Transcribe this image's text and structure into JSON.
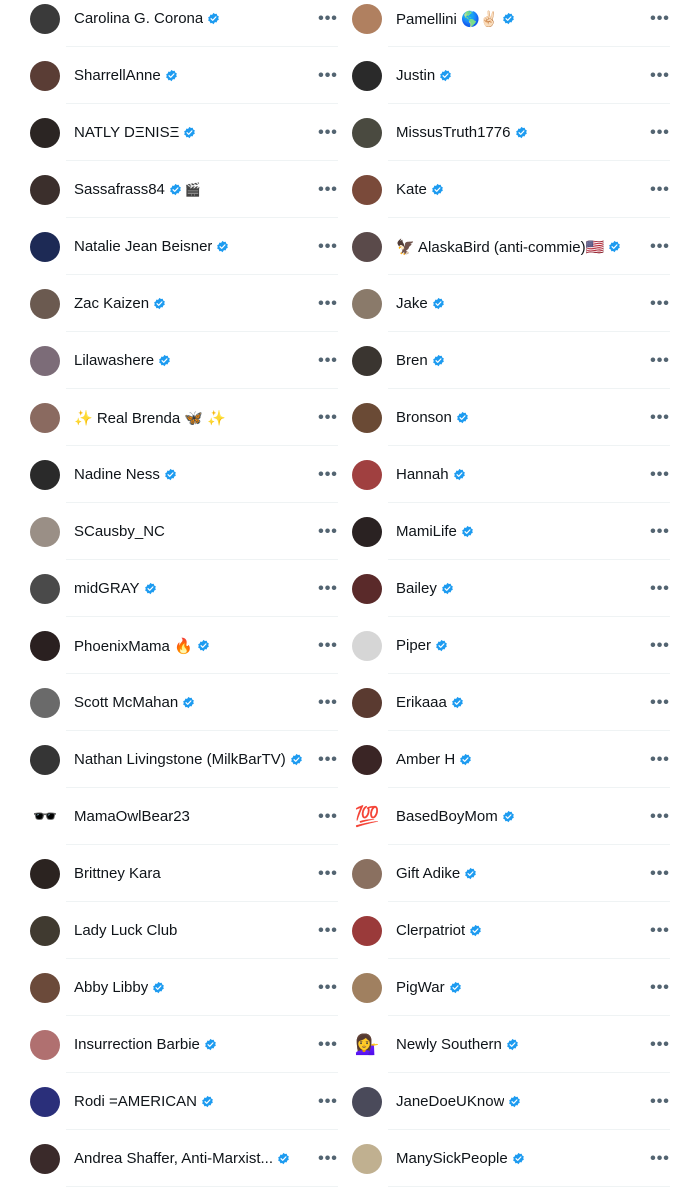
{
  "left_column": [
    {
      "name": "Carolina G. Corona",
      "verified": true,
      "extra": "",
      "avatar_color": "#3a3a3a",
      "avatar_emoji": ""
    },
    {
      "name": "SharrellAnne",
      "verified": true,
      "extra": "",
      "avatar_color": "#5a3d35",
      "avatar_emoji": ""
    },
    {
      "name": "NATLY DΞNISΞ",
      "verified": true,
      "extra": "",
      "avatar_color": "#2b2523",
      "avatar_emoji": ""
    },
    {
      "name": "Sassafrass84",
      "verified": true,
      "extra": "🎬",
      "avatar_color": "#3b2f2c",
      "avatar_emoji": ""
    },
    {
      "name": "Natalie Jean Beisner",
      "verified": true,
      "extra": "",
      "avatar_color": "#1d2a55",
      "avatar_emoji": ""
    },
    {
      "name": "Zac Kaizen",
      "verified": true,
      "extra": "",
      "avatar_color": "#6b5a50",
      "avatar_emoji": ""
    },
    {
      "name": "Lilawashere",
      "verified": true,
      "extra": "",
      "avatar_color": "#7c6c78",
      "avatar_emoji": ""
    },
    {
      "name": "✨ Real Brenda 🦋 ✨",
      "verified": false,
      "extra": "",
      "avatar_color": "#8a6a60",
      "avatar_emoji": ""
    },
    {
      "name": "Nadine Ness",
      "verified": true,
      "extra": "",
      "avatar_color": "#2a2a2a",
      "avatar_emoji": ""
    },
    {
      "name": "SCausby_NC",
      "verified": false,
      "extra": "",
      "avatar_color": "#9a8f86",
      "avatar_emoji": ""
    },
    {
      "name": "midGRAY",
      "verified": true,
      "extra": "",
      "avatar_color": "#4a4a4a",
      "avatar_emoji": ""
    },
    {
      "name": "PhoenixMama 🔥",
      "verified": true,
      "extra": "",
      "avatar_color": "#2a2020",
      "avatar_emoji": ""
    },
    {
      "name": "Scott McMahan",
      "verified": true,
      "extra": "",
      "avatar_color": "#6a6a6a",
      "avatar_emoji": ""
    },
    {
      "name": "Nathan Livingstone (MilkBarTV)",
      "verified": true,
      "extra": "",
      "avatar_color": "#353535",
      "avatar_emoji": ""
    },
    {
      "name": "MamaOwlBear23",
      "verified": false,
      "extra": "",
      "avatar_color": "#e9d6c4",
      "avatar_emoji": "🕶️"
    },
    {
      "name": "Brittney Kara",
      "verified": false,
      "extra": "",
      "avatar_color": "#2b2320",
      "avatar_emoji": ""
    },
    {
      "name": "Lady Luck Club",
      "verified": false,
      "extra": "",
      "avatar_color": "#403a30",
      "avatar_emoji": ""
    },
    {
      "name": "Abby Libby",
      "verified": true,
      "extra": "",
      "avatar_color": "#6b4a3a",
      "avatar_emoji": ""
    },
    {
      "name": "Insurrection Barbie",
      "verified": true,
      "extra": "",
      "avatar_color": "#b07070",
      "avatar_emoji": ""
    },
    {
      "name": "Rodi =AMERICAN",
      "verified": true,
      "extra": "",
      "avatar_color": "#2a2f7a",
      "avatar_emoji": ""
    },
    {
      "name": "Andrea Shaffer, Anti-Marxist...",
      "verified": true,
      "extra": "",
      "avatar_color": "#3a2a2a",
      "avatar_emoji": ""
    }
  ],
  "right_column": [
    {
      "name": "Pamellini 🌎✌🏻",
      "verified": true,
      "extra": "",
      "avatar_color": "#b08060",
      "avatar_emoji": ""
    },
    {
      "name": "Justin",
      "verified": true,
      "extra": "",
      "avatar_color": "#2a2a2a",
      "avatar_emoji": ""
    },
    {
      "name": "MissusTruth1776",
      "verified": true,
      "extra": "",
      "avatar_color": "#4a4a40",
      "avatar_emoji": ""
    },
    {
      "name": "Kate",
      "verified": true,
      "extra": "",
      "avatar_color": "#7a4a3a",
      "avatar_emoji": ""
    },
    {
      "name": "🦅 AlaskaBird (anti-commie)🇺🇸",
      "verified": true,
      "extra": "",
      "avatar_color": "#5a4a4a",
      "avatar_emoji": ""
    },
    {
      "name": "Jake",
      "verified": true,
      "extra": "",
      "avatar_color": "#8a7a6a",
      "avatar_emoji": ""
    },
    {
      "name": "Bren",
      "verified": true,
      "extra": "",
      "avatar_color": "#3a3530",
      "avatar_emoji": ""
    },
    {
      "name": "Bronson",
      "verified": true,
      "extra": "",
      "avatar_color": "#6a4a35",
      "avatar_emoji": ""
    },
    {
      "name": "Hannah",
      "verified": true,
      "extra": "",
      "avatar_color": "#a04040",
      "avatar_emoji": ""
    },
    {
      "name": "MamiLife",
      "verified": true,
      "extra": "",
      "avatar_color": "#2a2222",
      "avatar_emoji": ""
    },
    {
      "name": "Bailey",
      "verified": true,
      "extra": "",
      "avatar_color": "#5a2a2a",
      "avatar_emoji": ""
    },
    {
      "name": "Piper",
      "verified": true,
      "extra": "",
      "avatar_color": "#d6d6d6",
      "avatar_emoji": ""
    },
    {
      "name": "Erikaaa",
      "verified": true,
      "extra": "",
      "avatar_color": "#5a3a30",
      "avatar_emoji": ""
    },
    {
      "name": "Amber H",
      "verified": true,
      "extra": "",
      "avatar_color": "#3a2525",
      "avatar_emoji": ""
    },
    {
      "name": "BasedBoyMom",
      "verified": true,
      "extra": "",
      "avatar_color": "#ffffff",
      "avatar_emoji": "💯"
    },
    {
      "name": "Gift Adike",
      "verified": true,
      "extra": "",
      "avatar_color": "#8a7060",
      "avatar_emoji": ""
    },
    {
      "name": "Clerpatriot",
      "verified": true,
      "extra": "",
      "avatar_color": "#9a3a3a",
      "avatar_emoji": ""
    },
    {
      "name": "PigWar",
      "verified": true,
      "extra": "",
      "avatar_color": "#a08060",
      "avatar_emoji": ""
    },
    {
      "name": "Newly Southern",
      "verified": true,
      "extra": "",
      "avatar_color": "#ffffff",
      "avatar_emoji": "💁‍♀️"
    },
    {
      "name": "JaneDoeUKnow",
      "verified": true,
      "extra": "",
      "avatar_color": "#4a4a5a",
      "avatar_emoji": ""
    },
    {
      "name": "ManySickPeople",
      "verified": true,
      "extra": "",
      "avatar_color": "#c0b090",
      "avatar_emoji": ""
    }
  ],
  "more_label": "•••",
  "colors": {
    "verified": "#1d9bf0",
    "more": "#536471",
    "divider": "#eff3f4"
  }
}
